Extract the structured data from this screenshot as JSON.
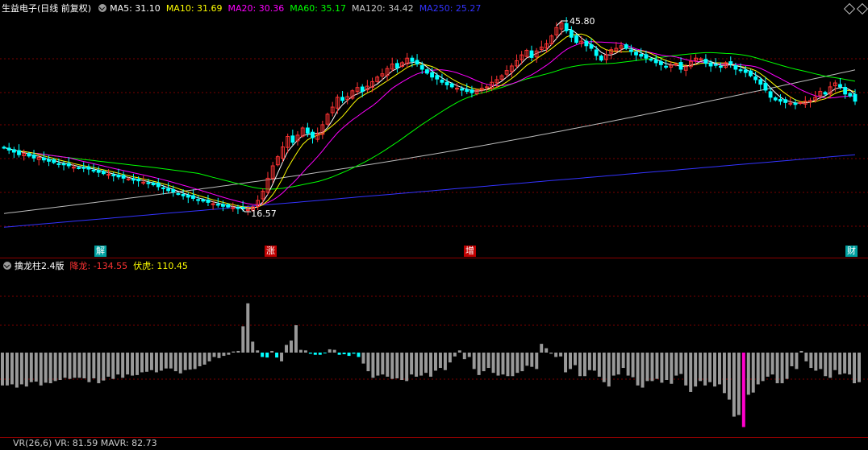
{
  "header": {
    "stock": "生益电子(日线 前复权)",
    "ma": [
      {
        "text": "MA5: 31.10",
        "color": "#ffffff"
      },
      {
        "text": "MA10: 31.69",
        "color": "#ffff00"
      },
      {
        "text": "MA20: 30.36",
        "color": "#ff00ff"
      },
      {
        "text": "MA60: 35.17",
        "color": "#00ff00"
      },
      {
        "text": "MA120: 34.42",
        "color": "#cccccc"
      },
      {
        "text": "MA250: 25.27",
        "color": "#3333ff"
      }
    ]
  },
  "annotations": {
    "high": "45.80",
    "low": "16.57"
  },
  "event_tags": [
    {
      "label": "解",
      "color": "#00a0a0"
    },
    {
      "label": "涨",
      "color": "#c00000"
    },
    {
      "label": "增",
      "color": "#c00000"
    },
    {
      "label": "财",
      "color": "#00a0a0"
    }
  ],
  "indicator": {
    "name": "擒龙柱2.4版",
    "jianglong": "降龙: -134.55",
    "fuhu": "伏虎: 110.45",
    "jianglong_color": "#ff3333",
    "fuhu_color": "#ffff00"
  },
  "bottom_header": "VR(26,6)  VR: 81.59  MAVR: 82.73",
  "colors": {
    "up": "#ff3333",
    "down": "#00ffff",
    "bar": "#999999",
    "highlight": "#ff00cc",
    "grid": "#7a0000"
  },
  "chart_data": {
    "type": "candlestick",
    "high_label": 45.8,
    "low_label": 16.57,
    "closes": [
      26.4,
      26.0,
      25.7,
      25.3,
      25.5,
      25.1,
      24.8,
      24.9,
      24.5,
      24.3,
      24.1,
      23.9,
      23.8,
      23.6,
      23.4,
      23.3,
      23.2,
      23.1,
      22.9,
      22.6,
      22.4,
      22.3,
      22.1,
      21.9,
      21.7,
      21.6,
      21.4,
      21.3,
      21.1,
      20.9,
      20.7,
      20.4,
      20.1,
      19.8,
      19.6,
      19.3,
      19.0,
      18.8,
      18.6,
      18.4,
      18.2,
      18.0,
      17.8,
      17.6,
      17.4,
      17.3,
      17.2,
      17.1,
      17.0,
      16.9,
      17.3,
      18.3,
      19.7,
      21.7,
      23.6,
      25.0,
      26.5,
      28.1,
      27.2,
      28.3,
      29.4,
      28.6,
      27.9,
      28.5,
      29.9,
      31.5,
      32.6,
      34.1,
      33.6,
      34.2,
      35.1,
      35.6,
      35.0,
      35.8,
      36.5,
      37.2,
      37.7,
      38.5,
      39.2,
      38.6,
      39.4,
      40.1,
      39.6,
      39.2,
      38.4,
      37.8,
      37.2,
      36.9,
      36.4,
      36.0,
      35.7,
      35.5,
      35.2,
      35.0,
      34.8,
      35.2,
      35.5,
      35.7,
      36.4,
      36.8,
      37.4,
      38.2,
      38.9,
      39.7,
      40.6,
      41.3,
      40.2,
      41.2,
      41.8,
      42.3,
      43.5,
      44.8,
      45.5,
      44.3,
      43.3,
      42.5,
      42.7,
      42.0,
      41.6,
      40.5,
      39.8,
      40.6,
      41.4,
      41.6,
      42.0,
      41.6,
      41.1,
      40.6,
      40.4,
      40.1,
      39.8,
      39.4,
      39.1,
      38.8,
      39.0,
      39.2,
      38.4,
      38.8,
      39.6,
      40.1,
      40.0,
      39.3,
      38.9,
      39.0,
      38.7,
      39.4,
      39.2,
      38.4,
      38.2,
      37.9,
      37.4,
      36.8,
      36.1,
      35.2,
      34.1,
      33.7,
      33.5,
      33.3,
      33.2,
      33.0,
      33.3,
      33.5,
      33.6,
      34.1,
      35.0,
      34.6,
      35.7,
      36.3,
      35.7,
      34.6,
      34.3,
      33.5
    ],
    "indicator_values": [
      -60,
      -60,
      -58,
      -64,
      -58,
      -62,
      -54,
      -53,
      -60,
      -55,
      -56,
      -52,
      -50,
      -46,
      -48,
      -46,
      -46,
      -47,
      -54,
      -47,
      -56,
      -51,
      -44,
      -48,
      -40,
      -46,
      -40,
      -42,
      -41,
      -36,
      -35,
      -32,
      -36,
      -33,
      -29,
      -29,
      -34,
      -38,
      -32,
      -31,
      -30,
      -25,
      -22,
      -16,
      -8,
      -10,
      -6,
      -4,
      2,
      3,
      48,
      90,
      20,
      4,
      -8,
      -9,
      3,
      -9,
      -16,
      14,
      22,
      50,
      5,
      4,
      -2,
      -4,
      -4,
      -1,
      6,
      5,
      -4,
      -3,
      -6,
      -2,
      -8,
      -20,
      -34,
      -46,
      -42,
      -40,
      -44,
      -48,
      -47,
      -50,
      -52,
      -40,
      -44,
      -42,
      -37,
      -44,
      -33,
      -28,
      -32,
      -18,
      -7,
      4,
      -12,
      -8,
      -30,
      -41,
      -34,
      -28,
      -37,
      -42,
      -40,
      -43,
      -43,
      -37,
      -34,
      -24,
      -26,
      -30,
      16,
      8,
      -2,
      -8,
      -7,
      -36,
      -30,
      -23,
      -43,
      -43,
      -32,
      -33,
      -44,
      -54,
      -62,
      -42,
      -40,
      -28,
      -42,
      -45,
      -60,
      -64,
      -52,
      -52,
      -48,
      -55,
      -50,
      -57,
      -42,
      -39,
      -60,
      -72,
      -62,
      -52,
      -60,
      -54,
      -62,
      -58,
      -74,
      -86,
      -117,
      -114,
      -136,
      -77,
      -73,
      -58,
      -52,
      -44,
      -40,
      -56,
      -56,
      -48,
      -25,
      -30,
      3,
      -16,
      -28,
      -33,
      -30,
      -43,
      -46,
      -32,
      -40,
      -38,
      -40,
      -56,
      -54
    ]
  }
}
